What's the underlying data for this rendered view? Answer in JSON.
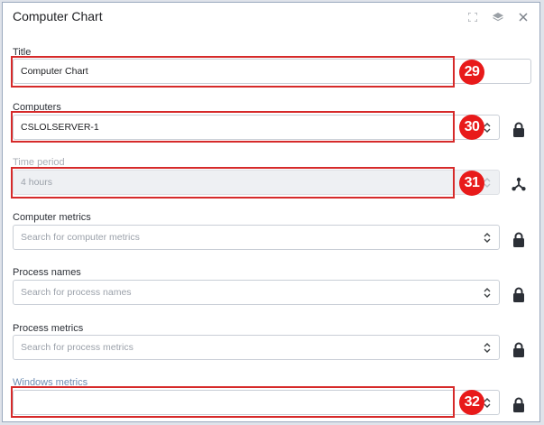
{
  "window": {
    "title": "Computer Chart"
  },
  "fields": {
    "title": {
      "label": "Title",
      "value": "Computer Chart"
    },
    "computers": {
      "label": "Computers",
      "value": "CSLOLSERVER-1"
    },
    "time_period": {
      "label": "Time period",
      "value": "4 hours"
    },
    "computer_metrics": {
      "label": "Computer metrics",
      "placeholder": "Search for computer metrics"
    },
    "process_names": {
      "label": "Process names",
      "placeholder": "Search for process names"
    },
    "process_metrics": {
      "label": "Process metrics",
      "placeholder": "Search for process metrics"
    },
    "windows_metrics": {
      "label": "Windows metrics",
      "value": ""
    }
  },
  "annotations": [
    {
      "number": "29"
    },
    {
      "number": "30"
    },
    {
      "number": "31"
    },
    {
      "number": "32"
    }
  ],
  "icons": {
    "titlebar": [
      "expand-icon",
      "layers-icon",
      "close-icon"
    ],
    "side": [
      "lock-icon",
      "hierarchy-icon"
    ]
  },
  "colors": {
    "highlight": "#d62a2a",
    "badge": "#e81a1a",
    "disabled_label": "#a9aeb6",
    "accent_label": "#6f8db3"
  }
}
